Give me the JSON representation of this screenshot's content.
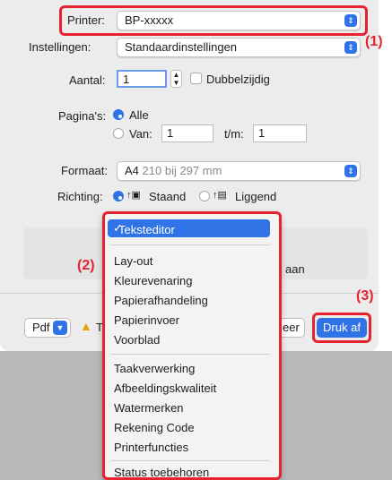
{
  "printer": {
    "label": "Printer:",
    "value": "BP-xxxxx"
  },
  "presets": {
    "label": "Instellingen:",
    "value": "Standaardinstellingen"
  },
  "copies": {
    "label": "Aantal:",
    "value": "1",
    "duplex_label": "Dubbelzijdig"
  },
  "pages": {
    "label": "Pagina's:",
    "all_label": "Alle",
    "from_label": "Van:",
    "from_value": "1",
    "to_label": "t/m:",
    "to_value": "1"
  },
  "paper_size": {
    "label": "Formaat:",
    "value": "A4",
    "dimensions": "210 bij 297 mm"
  },
  "orientation": {
    "label": "Richting:",
    "portrait_label": "Staand",
    "landscape_label": "Liggend"
  },
  "dropdown": {
    "selected": "Teksteditor",
    "group1": [
      "Lay-out",
      "Kleurevenaring",
      "Papierafhandeling",
      "Papierinvoer",
      "Voorblad"
    ],
    "group2": [
      "Taakverwerking",
      "Afbeeldingskwaliteit",
      "Watermerken",
      "Rekening Code",
      "Printerfuncties"
    ],
    "group3": [
      "Status toebehoren"
    ]
  },
  "partial_text": {
    "left": "T",
    "right_panel": "aan",
    "cancel_fragment": "eer"
  },
  "footer": {
    "pdf_label": "Pdf",
    "print_label": "Druk af"
  },
  "callouts": {
    "c1": "(1)",
    "c2": "(2)",
    "c3": "(3)"
  },
  "colors": {
    "accent": "#2f73e6",
    "highlight": "#e52330",
    "dialog_bg": "#ececec"
  }
}
